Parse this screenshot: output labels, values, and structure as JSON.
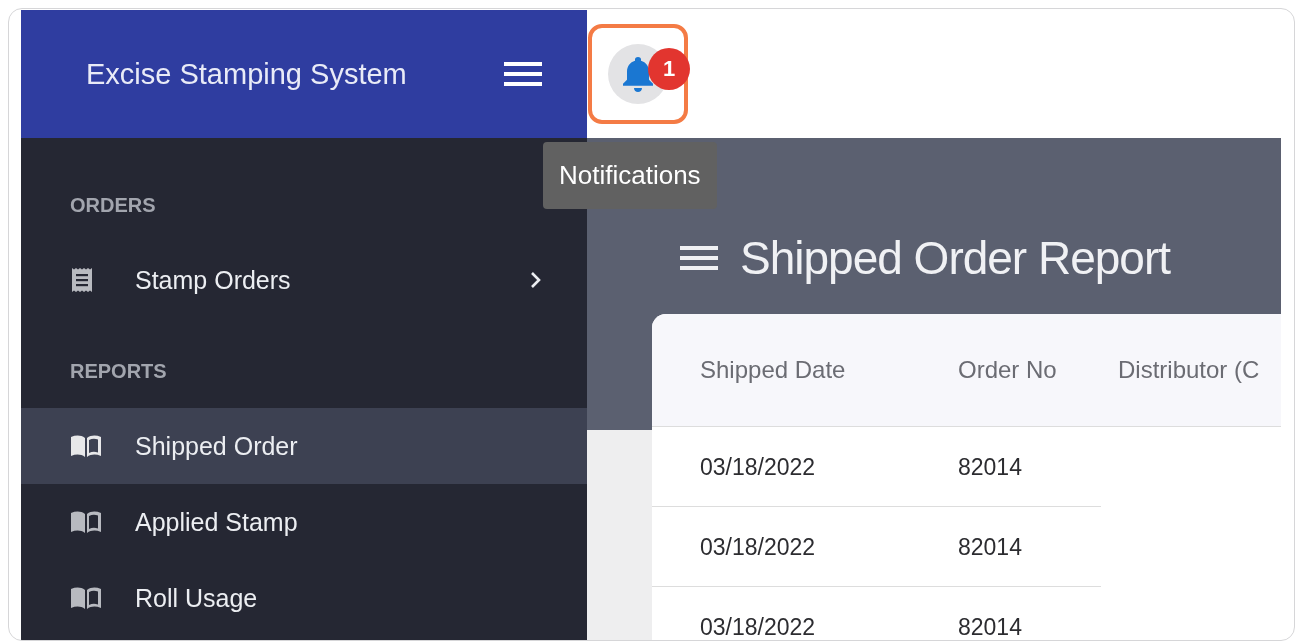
{
  "sidebar": {
    "title": "Excise Stamping System",
    "sections": [
      {
        "heading": "ORDERS",
        "items": [
          {
            "label": "Stamp Orders",
            "kind": "order",
            "expandable": true,
            "selected": false
          }
        ]
      },
      {
        "heading": "REPORTS",
        "items": [
          {
            "label": "Shipped Order",
            "kind": "report",
            "expandable": false,
            "selected": true
          },
          {
            "label": "Applied Stamp",
            "kind": "report",
            "expandable": false,
            "selected": false
          },
          {
            "label": "Roll Usage",
            "kind": "report",
            "expandable": false,
            "selected": false
          }
        ]
      }
    ]
  },
  "topbar": {
    "notification_count": "1",
    "highlighted": true,
    "tooltip": "Notifications"
  },
  "page": {
    "title": "Shipped Order Report"
  },
  "table": {
    "columns": [
      "Shipped Date",
      "Order No",
      "Distributor (C"
    ],
    "rows": [
      [
        "03/18/2022",
        "82014"
      ],
      [
        "03/18/2022",
        "82014"
      ],
      [
        "03/18/2022",
        "82014"
      ]
    ]
  }
}
